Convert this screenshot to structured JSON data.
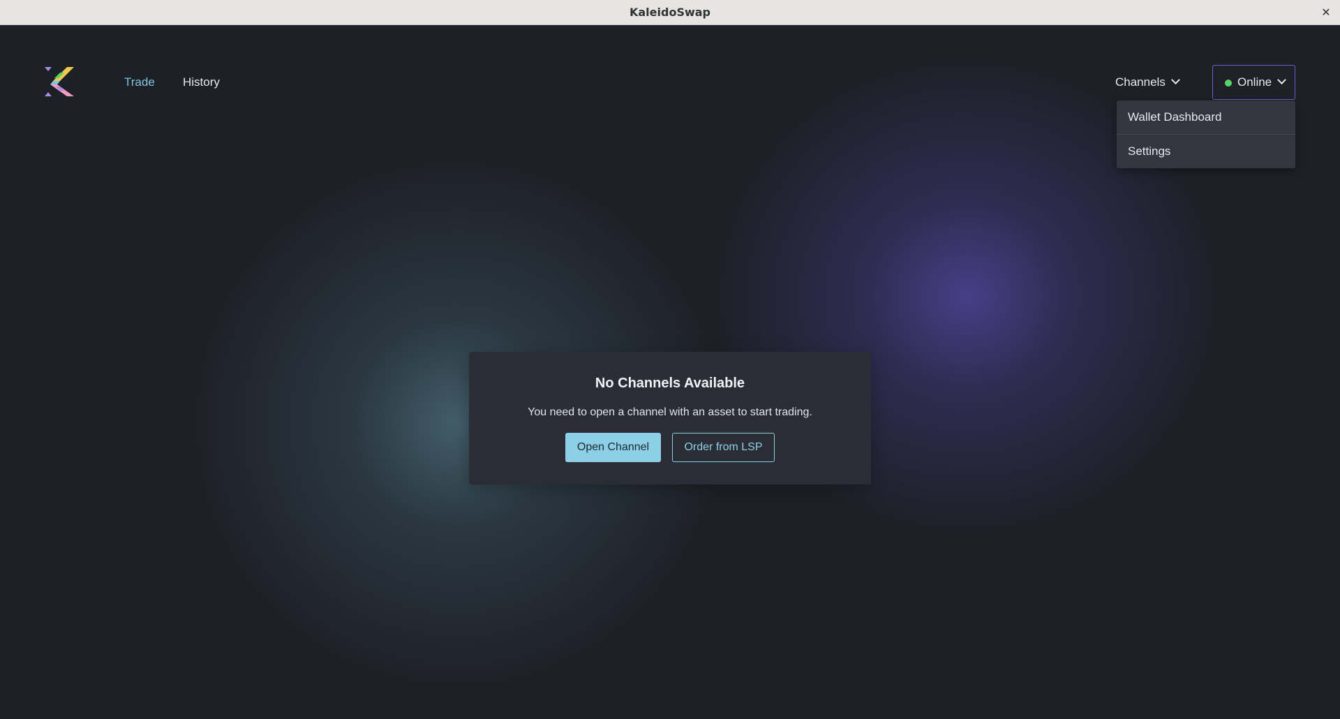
{
  "window": {
    "title": "KaleidoSwap",
    "close_glyph": "✕"
  },
  "nav": {
    "trade_label": "Trade",
    "history_label": "History",
    "active": "Trade"
  },
  "header": {
    "channels_label": "Channels",
    "status_label": "Online",
    "status_color": "#56d364"
  },
  "dropdown": {
    "items": [
      {
        "label": "Wallet Dashboard"
      },
      {
        "label": "Settings"
      }
    ]
  },
  "modal": {
    "title": "No Channels Available",
    "message": "You need to open a channel with an asset to start trading.",
    "primary_button": "Open Channel",
    "secondary_button": "Order from LSP"
  },
  "colors": {
    "accent": "#8ccfe6",
    "nav_active": "#7ec4dd",
    "status_border": "#6b63c9",
    "background": "#1e2027"
  },
  "icons": {
    "logo": "kaleidoswap-logo",
    "chevron": "chevron-down-icon",
    "status": "status-dot-icon"
  }
}
